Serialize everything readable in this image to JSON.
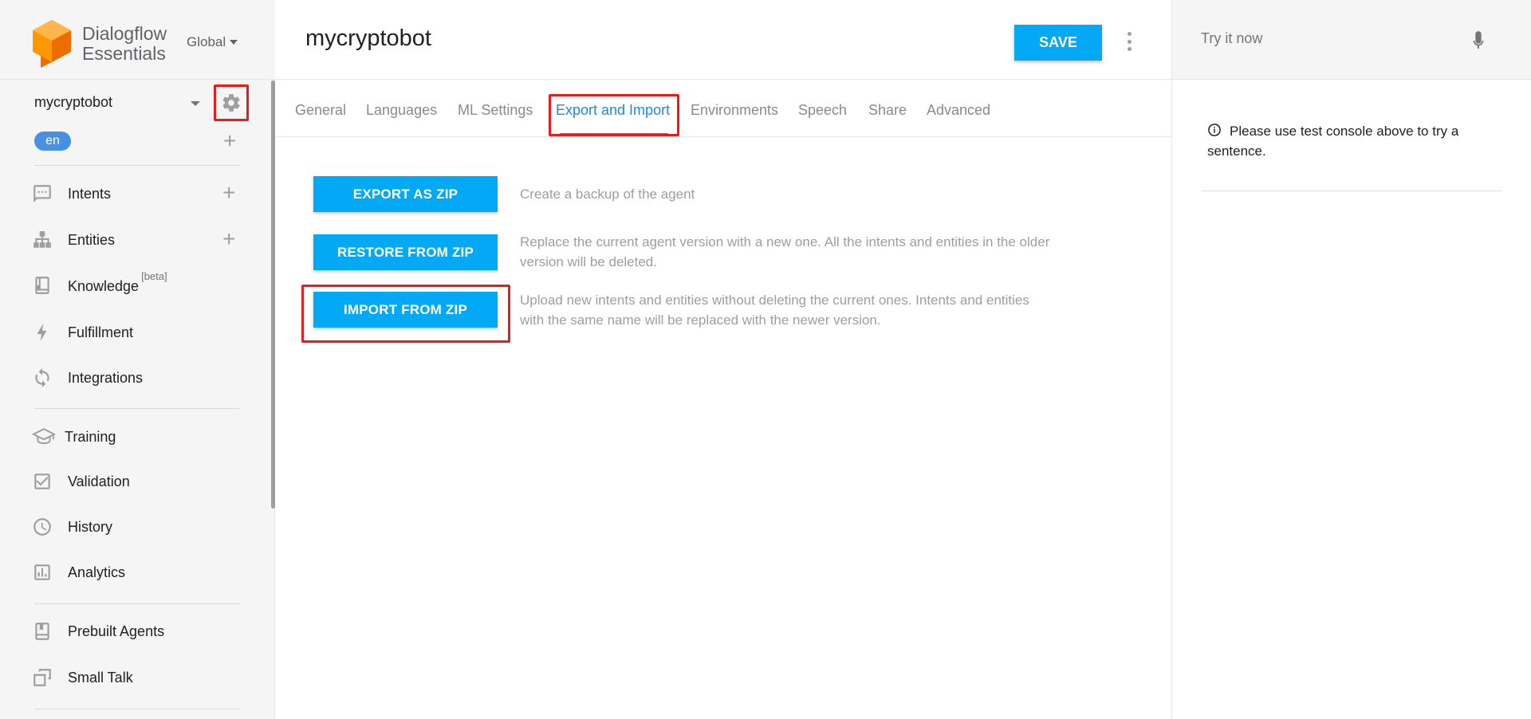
{
  "app": {
    "brand_line1": "Dialogflow",
    "brand_line2": "Essentials",
    "region": "Global"
  },
  "sidebar": {
    "agent_name": "mycryptobot",
    "language": "en",
    "items": [
      {
        "label": "Intents",
        "icon": "chat-bubble-icon"
      },
      {
        "label": "Entities",
        "icon": "hierarchy-icon"
      },
      {
        "label": "Knowledge",
        "badge": "[beta]",
        "icon": "book-icon"
      },
      {
        "label": "Fulfillment",
        "icon": "lightning-icon"
      },
      {
        "label": "Integrations",
        "icon": "sync-icon"
      },
      {
        "label": "Training",
        "icon": "graduation-cap-icon"
      },
      {
        "label": "Validation",
        "icon": "checkbox-icon"
      },
      {
        "label": "History",
        "icon": "clock-icon"
      },
      {
        "label": "Analytics",
        "icon": "bar-chart-icon"
      },
      {
        "label": "Prebuilt Agents",
        "icon": "bookmark-book-icon"
      },
      {
        "label": "Small Talk",
        "icon": "stacked-windows-icon"
      }
    ]
  },
  "main": {
    "title": "mycryptobot",
    "save_label": "SAVE",
    "tabs": [
      {
        "label": "General"
      },
      {
        "label": "Languages"
      },
      {
        "label": "ML Settings"
      },
      {
        "label": "Export and Import",
        "active": true
      },
      {
        "label": "Environments"
      },
      {
        "label": "Speech"
      },
      {
        "label": "Share"
      },
      {
        "label": "Advanced"
      }
    ],
    "actions": [
      {
        "button": "EXPORT AS ZIP",
        "description": "Create a backup of the agent"
      },
      {
        "button": "RESTORE FROM ZIP",
        "description": "Replace the current agent version with a new one. All the intents and entities in the older version will be deleted."
      },
      {
        "button": "IMPORT FROM ZIP",
        "description": "Upload new intents and entities without deleting the current ones. Intents and entities with the same name will be replaced with the newer version."
      }
    ]
  },
  "right_panel": {
    "try_placeholder": "Try it now",
    "info_text": "Please use test console above to try a sentence."
  },
  "colors": {
    "accent": "#03a9f4",
    "active_tab": "#1e88e5",
    "highlight": "#e81c1c",
    "logo_orange": "#ff9800"
  }
}
